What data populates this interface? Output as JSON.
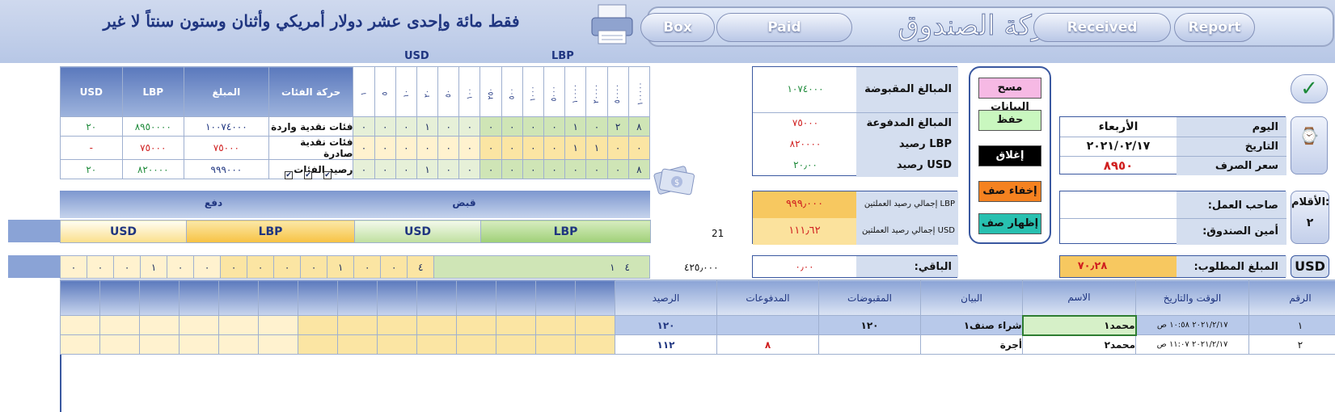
{
  "header": {
    "amount_in_words": "فقط مائة وإحدى عشر دولار أمريكي وأثنان وستون سنتاً لا غير",
    "nav": {
      "box": "Box",
      "paid": "Paid",
      "title": "حركة الصندوق",
      "received": "Received",
      "report": "Report"
    }
  },
  "sections": {
    "usd": "USD",
    "lbp": "LBP"
  },
  "denom_table": {
    "headers": {
      "usd": "USD",
      "lbp": "LBP",
      "amount": "المبلغ",
      "movement": "حركة الفئات"
    },
    "usd_cols": [
      "١",
      "٥",
      "١٠",
      "٢٠",
      "٥٠",
      "١٠٠"
    ],
    "lbp_cols": [
      "٢٥٠",
      "٥٠٠",
      "١٠٠٠",
      "٥٠٠٠",
      "١٠٠٠٠",
      "٢٠٠٠٠",
      "٥٠٠٠٠",
      "١٠٠٠٠٠"
    ],
    "rows": [
      {
        "label": "فئات نقدية واردة",
        "amount": "١٠٠٧٤٠٠٠",
        "lbp": "٨٩٥٠٠٠٠",
        "usd": "٢٠",
        "usd_vals": [
          "٠",
          "٠",
          "٠",
          "١",
          "٠",
          "٠"
        ],
        "lbp_vals": [
          "٠",
          "٠",
          "٠",
          "٠",
          "١",
          "٠",
          "٢",
          "٨"
        ]
      },
      {
        "label": "فئات نقدية صادرة",
        "amount": "٧٥٠٠٠",
        "lbp": "٧٥٠٠٠",
        "usd": "-",
        "usd_vals": [
          "٠",
          "٠",
          "٠",
          "٠",
          "٠",
          "٠"
        ],
        "lbp_vals": [
          "٠",
          "٠",
          "٠",
          "٠",
          "١",
          "١",
          "٠",
          "٠"
        ]
      },
      {
        "label": "رصيد الفئات",
        "amount": "٩٩٩٠٠٠",
        "lbp": "٨٢٠٠٠٠",
        "usd": "٢٠",
        "usd_vals": [
          "٠",
          "٠",
          "٠",
          "١",
          "٠",
          "٠"
        ],
        "lbp_vals": [
          "٠",
          "٠",
          "٠",
          "٠",
          "٠",
          "٠",
          "٠",
          "٨"
        ]
      }
    ]
  },
  "checks": [
    "✔",
    "✔",
    "✔"
  ],
  "summary": {
    "received_label": "المبالغ المقبوضة",
    "received": "١٠٧٤٠٠٠",
    "paid_label": "المبالغ المدفوعة",
    "paid": "٧٥٠٠٠",
    "lbp_bal_label": "LBP رصيد",
    "lbp_bal": "٨٢٠٠٠٠",
    "usd_bal_label": "USD رصيد",
    "usd_bal": "٢٠٫٠٠",
    "total_lbp_label": "LBP إجمالي رصيد العملتين",
    "total_lbp": "٩٩٩٫٠٠٠",
    "total_usd_label": "USD إجمالي رصيد العملتين",
    "total_usd": "١١١٫٦٢",
    "remaining_label": "الباقي:",
    "remaining": "٠٫٠٠",
    "remaining_amount": "٤٢٥٫٠٠٠",
    "count": "21"
  },
  "buttons": {
    "clear": "مسح البيانات",
    "save": "حفظ",
    "close": "إغلاق",
    "hide_row": "إخفاء صف",
    "show_row": "إظهار صف"
  },
  "info": {
    "day_label": "اليوم",
    "day": "الأربعاء",
    "date_label": "التاريخ",
    "date": "٢٠٢١/٠٢/١٧",
    "rate_label": "سعر الصرف",
    "rate": "٨٩٥٠",
    "owner_label": "صاحب العمل:",
    "cashier_label": "أمين الصندوق:",
    "pens_label": "الأقلام:",
    "pens": "٢",
    "required_label": "المبلغ المطلوب:",
    "required": "٧٠٫٢٨",
    "usd_tag": "USD"
  },
  "receipt": {
    "receive": "قبض",
    "pay": "دفع",
    "usd": "USD",
    "lbp": "LBP",
    "pay_usd_vals": [
      "٠",
      "٠",
      "٠",
      "١",
      "٠",
      "٠"
    ],
    "pay_lbp_vals": [
      "٠",
      "٠",
      "٠",
      "٠",
      "١",
      "٠",
      "٠",
      "٤"
    ],
    "rec_usd_val": "١",
    "rec_lbp_val": "١",
    "rec_lbp_val2": "٤"
  },
  "ledger": {
    "headers": {
      "num": "الرقم",
      "datetime": "الوقت والتاريخ",
      "name": "الاسم",
      "desc": "البيان",
      "received": "المقبوضات",
      "paid": "المدفوعات",
      "balance": "الرصيد"
    },
    "rows": [
      {
        "num": "١",
        "datetime": "٢٠٢١/٢/١٧  ١٠:٥٨ ص",
        "name": "محمد١",
        "desc": "شراء صنف١",
        "received": "١٢٠",
        "paid": "",
        "balance": "١٢٠"
      },
      {
        "num": "٢",
        "datetime": "٢٠٢١/٢/١٧  ١١:٠٧ ص",
        "name": "محمد٢",
        "desc": "أجرة",
        "received": "",
        "paid": "٨",
        "balance": "١١٢"
      }
    ]
  }
}
